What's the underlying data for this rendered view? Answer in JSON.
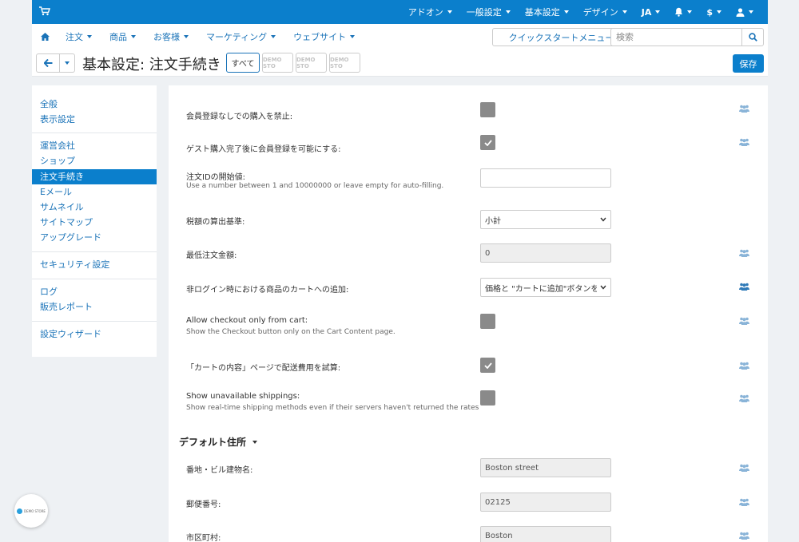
{
  "topbar": {
    "items": [
      {
        "label": "アドオン"
      },
      {
        "label": "一般設定"
      },
      {
        "label": "基本設定"
      },
      {
        "label": "デザイン"
      },
      {
        "label": "JA"
      },
      {
        "label": ""
      },
      {
        "label": "$"
      },
      {
        "label": ""
      }
    ]
  },
  "nav": {
    "items": [
      {
        "label": "注文"
      },
      {
        "label": "商品"
      },
      {
        "label": "お客様"
      },
      {
        "label": "マーケティング"
      },
      {
        "label": "ウェブサイト"
      }
    ],
    "quickstart": "クイックスタートメニュー",
    "search_placeholder": "検索"
  },
  "titlebar": {
    "title": "基本設定: 注文手続き",
    "stores": [
      "すべて",
      "DEMO STO",
      "DEMO STO",
      "DEMO STO"
    ],
    "save": "保存"
  },
  "sidebar": {
    "items": [
      {
        "label": "全般"
      },
      {
        "label": "表示設定"
      },
      {
        "label": "運営会社"
      },
      {
        "label": "ショップ"
      },
      {
        "label": "注文手続き"
      },
      {
        "label": "Eメール"
      },
      {
        "label": "サムネイル"
      },
      {
        "label": "サイトマップ"
      },
      {
        "label": "アップグレード"
      },
      {
        "label": "セキュリティ設定"
      },
      {
        "label": "ログ"
      },
      {
        "label": "販売レポート"
      },
      {
        "label": "設定ウィザード"
      }
    ]
  },
  "settings": [
    {
      "label": "会員登録なしでの購入を禁止:",
      "help": "",
      "checked": false
    },
    {
      "label": "ゲスト購入完了後に会員登録を可能にする:",
      "help": "",
      "checked": true
    },
    {
      "label": "注文IDの開始値:",
      "help": "Use a number between 1 and 10000000 or leave empty for auto-filling.",
      "value": ""
    },
    {
      "label": "税額の算出基準:",
      "help": "",
      "value": "小計"
    },
    {
      "label": "最低注文金額:",
      "help": "",
      "value": "0"
    },
    {
      "label": "非ログイン時における商品のカートへの追加:",
      "help": "",
      "value": "価格と \"カートに追加\"ボタンを表示"
    },
    {
      "label": "Allow checkout only from cart:",
      "help": "Show the Checkout button only on the Cart Content page.",
      "checked": false
    },
    {
      "label": "「カートの内容」ページで配送費用を試算:",
      "help": "",
      "checked": true
    },
    {
      "label": "Show unavailable shippings:",
      "help": "Show real-time shipping methods even if their servers haven't returned the rates",
      "checked": false
    }
  ],
  "address_section": {
    "title": "デフォルト住所",
    "fields": [
      {
        "label": "番地・ビル建物名:",
        "value": "Boston street"
      },
      {
        "label": "郵便番号:",
        "value": "02125"
      },
      {
        "label": "市区町村:",
        "value": "Boston"
      }
    ]
  },
  "badge": {
    "text": "DEMO STORE"
  },
  "colors": {
    "accent": "#0b7fcc",
    "link": "#1a73b8",
    "checkbox": "#8a8a8a"
  }
}
